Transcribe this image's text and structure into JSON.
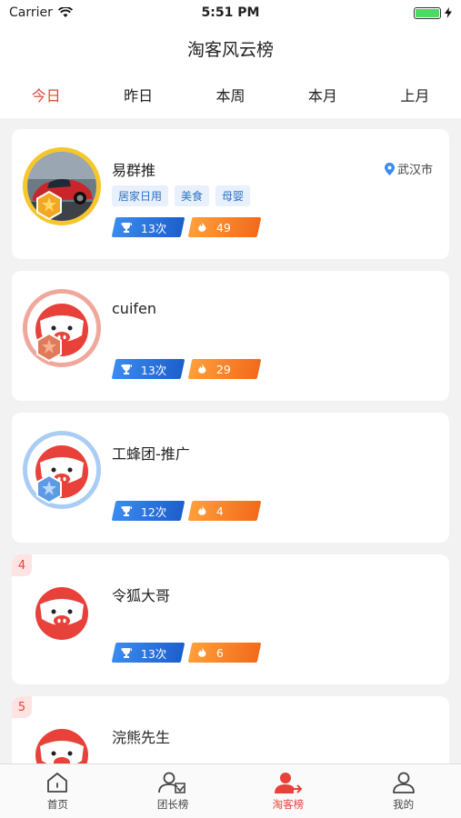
{
  "status_bar": {
    "carrier": "Carrier",
    "time": "5:51 PM"
  },
  "nav": {
    "title": "淘客风云榜"
  },
  "tabs": [
    {
      "label": "今日",
      "active": true
    },
    {
      "label": "昨日",
      "active": false
    },
    {
      "label": "本周",
      "active": false
    },
    {
      "label": "本月",
      "active": false
    },
    {
      "label": "上月",
      "active": false
    }
  ],
  "ranking": [
    {
      "rank": 1,
      "name": "易群推",
      "location": "武汉市",
      "tags": [
        "居家日用",
        "美食",
        "母婴"
      ],
      "times": "13次",
      "heat": "49",
      "medal": "gold"
    },
    {
      "rank": 2,
      "name": "cuifen",
      "times": "13次",
      "heat": "29",
      "medal": "bronze"
    },
    {
      "rank": 3,
      "name": "工蜂团-推广",
      "times": "12次",
      "heat": "4",
      "medal": "silver"
    },
    {
      "rank": 4,
      "rank_label": "4",
      "name": "令狐大哥",
      "times": "13次",
      "heat": "6"
    },
    {
      "rank": 5,
      "rank_label": "5",
      "name": "浣熊先生"
    }
  ],
  "tabbar": [
    {
      "label": "首页",
      "icon": "home-icon",
      "active": false
    },
    {
      "label": "团长榜",
      "icon": "leader-rank-icon",
      "active": false
    },
    {
      "label": "淘客榜",
      "icon": "taoke-rank-icon",
      "active": true
    },
    {
      "label": "我的",
      "icon": "profile-icon",
      "active": false
    }
  ],
  "colors": {
    "accent": "#e8413a",
    "tag_bg": "#e7f0fb",
    "tag_text": "#2f6fc7"
  }
}
